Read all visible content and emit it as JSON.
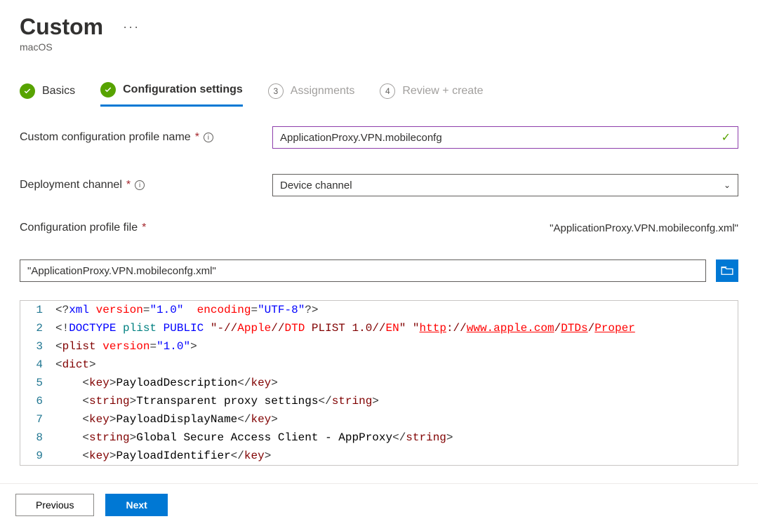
{
  "header": {
    "title": "Custom",
    "subtitle": "macOS"
  },
  "wizard": {
    "basics": "Basics",
    "config": "Configuration settings",
    "step3_num": "3",
    "assignments": "Assignments",
    "step4_num": "4",
    "review": "Review + create"
  },
  "form": {
    "profile_name_label": "Custom configuration profile name",
    "profile_name_value": "ApplicationProxy.VPN.mobileconfg",
    "deploy_channel_label": "Deployment channel",
    "deploy_channel_value": "Device channel",
    "profile_file_label": "Configuration profile file",
    "profile_file_display": "\"ApplicationProxy.VPN.mobileconfg.xml\"",
    "profile_file_value": "\"ApplicationProxy.VPN.mobileconfg.xml\""
  },
  "code": {
    "l1a": "<?",
    "l1b": "xml ",
    "l1c": "version",
    "l1d": "=",
    "l1e": "\"1.0\"",
    "l1f": "  ",
    "l1g": "encoding",
    "l1h": "=",
    "l1i": "\"UTF-8\"",
    "l1j": "?>",
    "l2a": "<!",
    "l2b": "DOCTYPE",
    "l2c": " plist ",
    "l2d": "PUBLIC",
    "l2e": " \"-//",
    "l2f": "Apple",
    "l2g": "//",
    "l2h": "DTD",
    "l2i": " PLIST 1.0//",
    "l2j": "EN",
    "l2k": "\" \"",
    "l2l": "http",
    "l2m": "://",
    "l2n": "www.apple.com",
    "l2o": "/",
    "l2p": "DTDs",
    "l2q": "/",
    "l2r": "Proper",
    "l3a": "<",
    "l3b": "plist",
    "l3c": " ",
    "l3d": "version",
    "l3e": "=",
    "l3f": "\"1.0\"",
    "l3g": ">",
    "l4a": "<",
    "l4b": "dict",
    "l4c": ">",
    "l5a": "    <",
    "l5b": "key",
    "l5c": ">",
    "l5d": "PayloadDescription",
    "l5e": "</",
    "l5f": "key",
    "l5g": ">",
    "l6a": "    <",
    "l6b": "string",
    "l6c": ">",
    "l6d": "Ttransparent proxy settings",
    "l6e": "</",
    "l6f": "string",
    "l6g": ">",
    "l7a": "    <",
    "l7b": "key",
    "l7c": ">",
    "l7d": "PayloadDisplayName",
    "l7e": "</",
    "l7f": "key",
    "l7g": ">",
    "l8a": "    <",
    "l8b": "string",
    "l8c": ">",
    "l8d": "Global Secure Access Client - AppProxy",
    "l8e": "</",
    "l8f": "string",
    "l8g": ">",
    "l9a": "    <",
    "l9b": "key",
    "l9c": ">",
    "l9d": "PayloadIdentifier",
    "l9e": "</",
    "l9f": "key",
    "l9g": ">"
  },
  "lines": {
    "n1": "1",
    "n2": "2",
    "n3": "3",
    "n4": "4",
    "n5": "5",
    "n6": "6",
    "n7": "7",
    "n8": "8",
    "n9": "9"
  },
  "footer": {
    "previous": "Previous",
    "next": "Next"
  },
  "misc": {
    "info_char": "i"
  }
}
